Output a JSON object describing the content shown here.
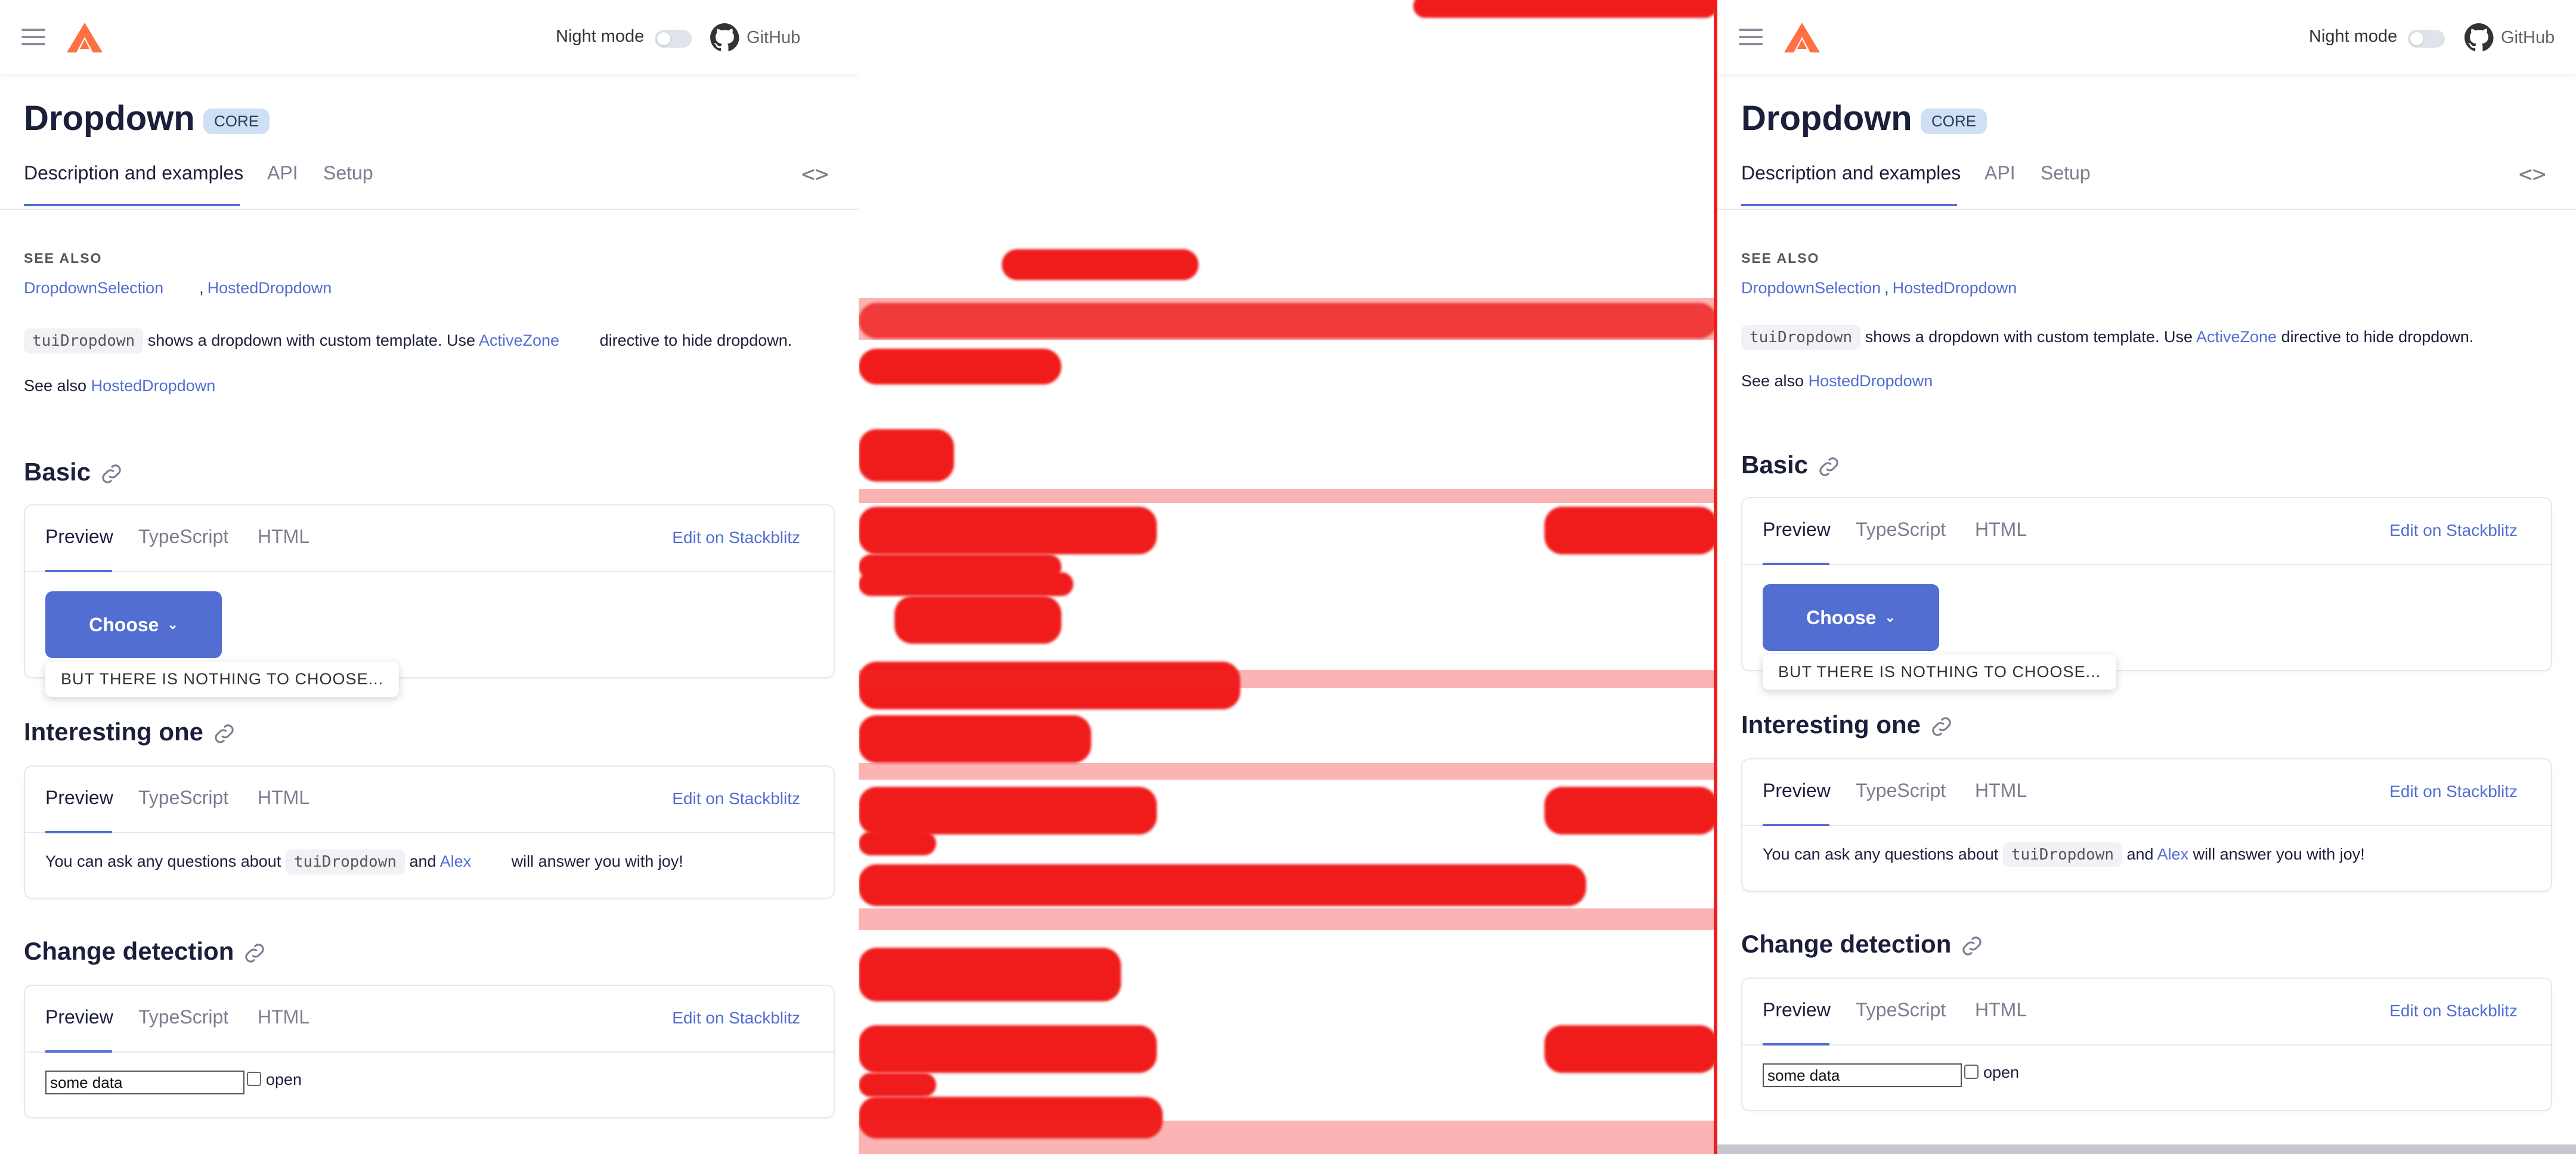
{
  "header": {
    "night_mode": "Night mode",
    "github": "GitHub"
  },
  "page": {
    "title": "Dropdown",
    "badge": "CORE",
    "tabs": [
      "Description and examples",
      "API",
      "Setup"
    ],
    "see_also_heading": "SEE ALSO",
    "see_also_links": [
      "DropdownSelection",
      "HostedDropdown"
    ],
    "see_also_sep": ",",
    "desc_code": "tuiDropdown",
    "desc_text_1": "shows a dropdown with custom template. Use",
    "desc_link": "ActiveZone",
    "desc_text_2": "directive to hide dropdown.",
    "see_also_prefix": "See also",
    "see_also_tail_link": "HostedDropdown"
  },
  "examples": {
    "tabs": [
      "Preview",
      "TypeScript",
      "HTML"
    ],
    "edit_label": "Edit on Stackblitz",
    "basic": {
      "heading": "Basic",
      "button": "Choose",
      "tooltip": "BUT THERE IS NOTHING TO CHOOSE..."
    },
    "interesting": {
      "heading": "Interesting one",
      "text_1": "You can ask any questions about",
      "code": "tuiDropdown",
      "text_2": "and",
      "link": "Alex",
      "text_3": "will answer you with joy!"
    },
    "change": {
      "heading": "Change detection",
      "input_value": "some data",
      "checkbox_label": "open"
    }
  },
  "colors": {
    "accent": "#526ed3",
    "logo": "#ff7043",
    "redaction": "#f01c1c"
  }
}
